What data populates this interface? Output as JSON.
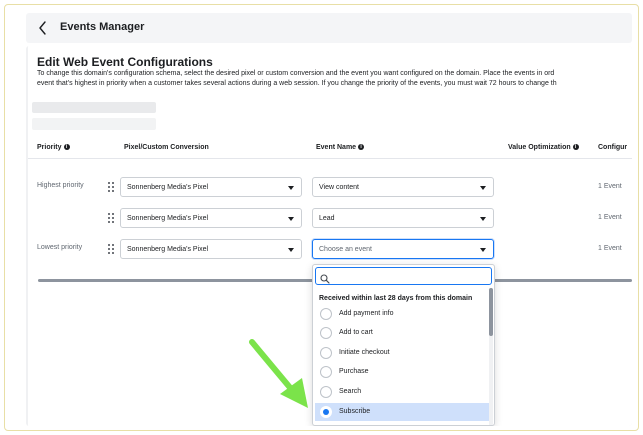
{
  "header": {
    "title": "Events Manager"
  },
  "page": {
    "title": "Edit Web Event Configurations",
    "description_line1": "To change this domain's configuration schema, select the desired pixel or custom conversion and the event you want configured on the domain. Place the events in ord",
    "description_line2": "event that's highest in priority when a customer takes several actions during a web session. If you change the priority of the events, you must wait 72 hours to change th"
  },
  "table": {
    "headers": {
      "priority": "Priority",
      "pixel": "Pixel/Custom Conversion",
      "event_name": "Event Name",
      "value_optimization": "Value Optimization",
      "configured": "Configur"
    },
    "rows": [
      {
        "priority": "Highest priority",
        "pixel": "Sonnenberg Media's Pixel",
        "event": "View content",
        "configured": "1 Event"
      },
      {
        "priority": "",
        "pixel": "Sonnenberg Media's Pixel",
        "event": "Lead",
        "configured": "1 Event"
      },
      {
        "priority": "Lowest priority",
        "pixel": "Sonnenberg Media's Pixel",
        "event": "Choose an event",
        "configured": "1 Event"
      }
    ]
  },
  "dropdown": {
    "search_placeholder": "",
    "section_label": "Received within last 28 days from this domain",
    "options": [
      {
        "label": "Add payment info",
        "selected": false
      },
      {
        "label": "Add to cart",
        "selected": false
      },
      {
        "label": "Initiate checkout",
        "selected": false
      },
      {
        "label": "Purchase",
        "selected": false
      },
      {
        "label": "Search",
        "selected": false
      },
      {
        "label": "Subscribe",
        "selected": true
      }
    ]
  },
  "icons": {
    "back": "chevron-left-icon",
    "info": "info-circle-icon",
    "drag": "drag-handle-icon",
    "search": "search-icon",
    "annotation_arrow": "green-arrow-icon"
  },
  "colors": {
    "accent": "#1877f2",
    "selected_bg": "#cfe0fb",
    "arrow": "#7be34a",
    "frame_border": "#e8dfa6"
  }
}
